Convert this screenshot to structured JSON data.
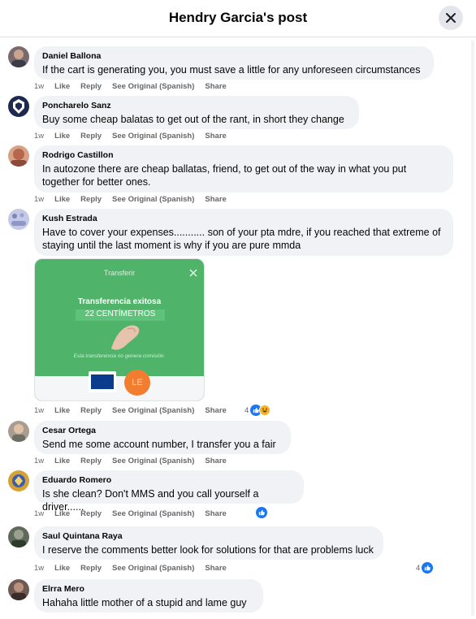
{
  "header": {
    "title": "Hendry Garcia's post"
  },
  "labels": {
    "like": "Like",
    "reply": "Reply",
    "see_original": "See Original (Spanish)",
    "share": "Share"
  },
  "icons": {
    "close": "close-icon",
    "like": "like-reaction-icon",
    "haha": "haha-reaction-icon"
  },
  "colors": {
    "bubble": "#f0f2f5",
    "meta": "#65676b",
    "like_blue": "#1877f2",
    "transfer_green": "#4fb469"
  },
  "comments": [
    {
      "author": "Daniel Ballona",
      "text": "If the cart is generating you, you must save a little for any unforeseen circumstances",
      "time": "1w"
    },
    {
      "author": "Poncharelo Sanz",
      "text": "Buy some cheap balatas to get out of the rant, in short they change",
      "time": "1w"
    },
    {
      "author": "Rodrigo Castillon",
      "text": "In autozone there are cheap ballatas, friend, to get out of the way in what you put together for better ones.",
      "time": "1w"
    },
    {
      "author": "Kush Estrada",
      "text": "Have to cover your expenses........... son of your pta mdre, if you reached that extreme of staying until the last moment is why if you are pure mmda",
      "time": "1w",
      "reaction_count": "4",
      "attachment": {
        "title": "Transferir",
        "status": "Transferencia exitosa",
        "amount": "22 CENTÍMETROS",
        "note": "Esta transferencia no genera comisión.",
        "badge": "LE"
      }
    },
    {
      "author": "Cesar Ortega",
      "text": "Send me some account number, I transfer you a fair",
      "time": "1w"
    },
    {
      "author": "Eduardo Romero",
      "text": "Is she clean? Don't MMS and you call yourself a driver......",
      "time": "1w"
    },
    {
      "author": "Saul Quintana Raya",
      "text": "I reserve the comments better look for solutions for that are problems luck",
      "time": "1w",
      "reaction_count": "4"
    },
    {
      "author": "Elrra Mero",
      "text": "Hahaha little mother of a stupid and lame guy"
    }
  ]
}
